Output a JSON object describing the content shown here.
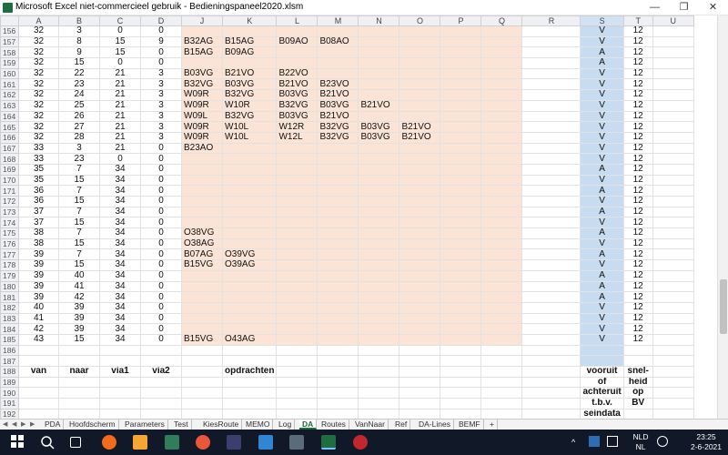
{
  "window": {
    "title": "Microsoft Excel niet-commercieel gebruik - Bedieningspaneel2020.xlsm",
    "minimize": "—",
    "restore": "❐",
    "close": "✕"
  },
  "columns": [
    "A",
    "B",
    "C",
    "D",
    "J",
    "K",
    "L",
    "M",
    "N",
    "O",
    "P",
    "Q",
    "R",
    "S",
    "T",
    "U"
  ],
  "rows": [
    {
      "n": "156",
      "a": "32",
      "b": "3",
      "c": "0",
      "d": "0",
      "ops": [],
      "s": "V",
      "t": "12"
    },
    {
      "n": "157",
      "a": "32",
      "b": "8",
      "c": "15",
      "d": "9",
      "ops": [
        "B32AG",
        "B15AG",
        "B09AO",
        "B08AO"
      ],
      "s": "V",
      "t": "12"
    },
    {
      "n": "158",
      "a": "32",
      "b": "9",
      "c": "15",
      "d": "0",
      "ops": [
        "B15AG",
        "B09AG"
      ],
      "s": "A",
      "t": "12"
    },
    {
      "n": "159",
      "a": "32",
      "b": "15",
      "c": "0",
      "d": "0",
      "ops": [],
      "s": "A",
      "t": "12"
    },
    {
      "n": "160",
      "a": "32",
      "b": "22",
      "c": "21",
      "d": "3",
      "ops": [
        "B03VG",
        "B21VO",
        "B22VO"
      ],
      "s": "V",
      "t": "12"
    },
    {
      "n": "161",
      "a": "32",
      "b": "23",
      "c": "21",
      "d": "3",
      "ops": [
        "B32VG",
        "B03VG",
        "B21VO",
        "B23VO"
      ],
      "s": "V",
      "t": "12"
    },
    {
      "n": "162",
      "a": "32",
      "b": "24",
      "c": "21",
      "d": "3",
      "ops": [
        "W09R",
        "B32VG",
        "B03VG",
        "B21VO"
      ],
      "s": "V",
      "t": "12"
    },
    {
      "n": "163",
      "a": "32",
      "b": "25",
      "c": "21",
      "d": "3",
      "ops": [
        "W09R",
        "W10R",
        "B32VG",
        "B03VG",
        "B21VO"
      ],
      "s": "V",
      "t": "12"
    },
    {
      "n": "164",
      "a": "32",
      "b": "26",
      "c": "21",
      "d": "3",
      "ops": [
        "W09L",
        "B32VG",
        "B03VG",
        "B21VO"
      ],
      "s": "V",
      "t": "12"
    },
    {
      "n": "165",
      "a": "32",
      "b": "27",
      "c": "21",
      "d": "3",
      "ops": [
        "W09R",
        "W10L",
        "W12R",
        "B32VG",
        "B03VG",
        "B21VO"
      ],
      "s": "V",
      "t": "12"
    },
    {
      "n": "166",
      "a": "32",
      "b": "28",
      "c": "21",
      "d": "3",
      "ops": [
        "W09R",
        "W10L",
        "W12L",
        "B32VG",
        "B03VG",
        "B21VO"
      ],
      "s": "V",
      "t": "12"
    },
    {
      "n": "167",
      "a": "33",
      "b": "3",
      "c": "21",
      "d": "0",
      "ops": [
        "B23AO"
      ],
      "s": "V",
      "t": "12"
    },
    {
      "n": "168",
      "a": "33",
      "b": "23",
      "c": "0",
      "d": "0",
      "ops": [],
      "s": "V",
      "t": "12"
    },
    {
      "n": "169",
      "a": "35",
      "b": "7",
      "c": "34",
      "d": "0",
      "ops": [],
      "s": "A",
      "t": "12"
    },
    {
      "n": "170",
      "a": "35",
      "b": "15",
      "c": "34",
      "d": "0",
      "ops": [],
      "s": "V",
      "t": "12"
    },
    {
      "n": "171",
      "a": "36",
      "b": "7",
      "c": "34",
      "d": "0",
      "ops": [],
      "s": "A",
      "t": "12"
    },
    {
      "n": "172",
      "a": "36",
      "b": "15",
      "c": "34",
      "d": "0",
      "ops": [],
      "s": "V",
      "t": "12"
    },
    {
      "n": "173",
      "a": "37",
      "b": "7",
      "c": "34",
      "d": "0",
      "ops": [],
      "s": "A",
      "t": "12"
    },
    {
      "n": "174",
      "a": "37",
      "b": "15",
      "c": "34",
      "d": "0",
      "ops": [],
      "s": "V",
      "t": "12"
    },
    {
      "n": "175",
      "a": "38",
      "b": "7",
      "c": "34",
      "d": "0",
      "ops": [
        "O38VG"
      ],
      "s": "A",
      "t": "12"
    },
    {
      "n": "176",
      "a": "38",
      "b": "15",
      "c": "34",
      "d": "0",
      "ops": [
        "O38AG"
      ],
      "s": "V",
      "t": "12"
    },
    {
      "n": "177",
      "a": "39",
      "b": "7",
      "c": "34",
      "d": "0",
      "ops": [
        "B07AG",
        "O39VG"
      ],
      "s": "A",
      "t": "12"
    },
    {
      "n": "178",
      "a": "39",
      "b": "15",
      "c": "34",
      "d": "0",
      "ops": [
        "B15VG",
        "O39AG"
      ],
      "s": "V",
      "t": "12"
    },
    {
      "n": "179",
      "a": "39",
      "b": "40",
      "c": "34",
      "d": "0",
      "ops": [],
      "s": "A",
      "t": "12"
    },
    {
      "n": "180",
      "a": "39",
      "b": "41",
      "c": "34",
      "d": "0",
      "ops": [],
      "s": "A",
      "t": "12"
    },
    {
      "n": "181",
      "a": "39",
      "b": "42",
      "c": "34",
      "d": "0",
      "ops": [],
      "s": "A",
      "t": "12"
    },
    {
      "n": "182",
      "a": "40",
      "b": "39",
      "c": "34",
      "d": "0",
      "ops": [],
      "s": "V",
      "t": "12"
    },
    {
      "n": "183",
      "a": "41",
      "b": "39",
      "c": "34",
      "d": "0",
      "ops": [],
      "s": "V",
      "t": "12"
    },
    {
      "n": "184",
      "a": "42",
      "b": "39",
      "c": "34",
      "d": "0",
      "ops": [],
      "s": "V",
      "t": "12"
    },
    {
      "n": "185",
      "a": "43",
      "b": "15",
      "c": "34",
      "d": "0",
      "ops": [
        "B15VG",
        "O43AG"
      ],
      "s": "V",
      "t": "12"
    }
  ],
  "empty_rows": [
    "186",
    "187"
  ],
  "footer_rows": [
    "188",
    "189",
    "190",
    "191",
    "192"
  ],
  "footer": {
    "van": "van",
    "naar": "naar",
    "via1": "via1",
    "via2": "via2",
    "opdrachten": "opdrachten",
    "s_lines": [
      "vooruit",
      "of",
      "achteruit",
      "t.b.v.",
      "seindata"
    ],
    "t_lines": [
      "snel-",
      "heid",
      "op",
      "BV",
      ""
    ]
  },
  "tabs": [
    "PDA",
    "Hoofdscherm",
    "Parameters",
    "Test",
    "KiesRoute",
    "MEMO",
    "Log",
    "DA",
    "Routes",
    "VanNaar",
    "Ref",
    "DA-Lines",
    "BEMF"
  ],
  "active_tab": "DA",
  "taskbar": {
    "lang1": "NLD",
    "lang2": "NL",
    "time": "23:25",
    "date": "2-6-2021"
  },
  "colors": {
    "fill_peach": "#fbe4d5",
    "fill_blue": "#c7dcf0",
    "excel_green": "#1d6f42"
  }
}
